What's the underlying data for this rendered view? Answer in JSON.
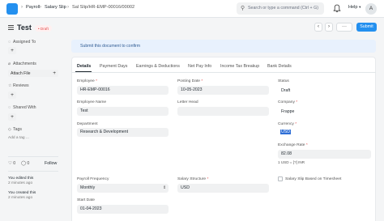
{
  "breadcrumbs": [
    "Payroll",
    "Salary Slip",
    "Sal Slip/HR-EMP-00016/00002"
  ],
  "search": {
    "placeholder": "Search or type a command (Ctrl + G)"
  },
  "header": {
    "help_label": "Help",
    "avatar_initial": "A",
    "title": "Test",
    "status_badge": "Draft",
    "submit_label": "Submit"
  },
  "sidebar": {
    "assigned_to": "Assigned To",
    "attachments": "Attachments",
    "attach_file": "Attach File",
    "reviews": "Reviews",
    "shared_with": "Shared With",
    "tags": "Tags",
    "add_tag": "Add a tag ...",
    "likes_count": "0",
    "comments_count": "0",
    "follow_label": "Follow",
    "activity": [
      {
        "user": "You",
        "action": "edited this",
        "time": "2 minutes ago"
      },
      {
        "user": "You",
        "action": "created this",
        "time": "2 minutes ago"
      }
    ]
  },
  "notice": "Submit this document to confirm",
  "tabs": [
    "Details",
    "Payment Days",
    "Earnings & Deductions",
    "Net Pay Info",
    "Income Tax Breakup",
    "Bank Details"
  ],
  "form": {
    "employee": {
      "label": "Employee",
      "value": "HR-EMP-00016"
    },
    "employee_name": {
      "label": "Employee Name",
      "value": "Test"
    },
    "department": {
      "label": "Department",
      "value": "Research & Development"
    },
    "posting_date": {
      "label": "Posting Date",
      "value": "10-05-2023"
    },
    "letter_head": {
      "label": "Letter Head",
      "value": ""
    },
    "status": {
      "label": "Status",
      "value": "Draft"
    },
    "company": {
      "label": "Company",
      "value": "Frappe"
    },
    "currency": {
      "label": "Currency",
      "value": "USD"
    },
    "exchange_rate": {
      "label": "Exchange Rate",
      "value": "82.08",
      "note": "1 USD = [?] INR"
    },
    "payroll_frequency": {
      "label": "Payroll Frequency",
      "value": "Monthly"
    },
    "salary_structure": {
      "label": "Salary Structure",
      "value": "USD"
    },
    "timesheet": {
      "label": "Salary Slip Based on Timesheet"
    },
    "start_date": {
      "label": "Start Date",
      "value": "01-04-2023"
    }
  },
  "colors": {
    "primary": "#2490ef",
    "draft": "#e24c4c",
    "notice_bg": "#e8f1fd"
  }
}
